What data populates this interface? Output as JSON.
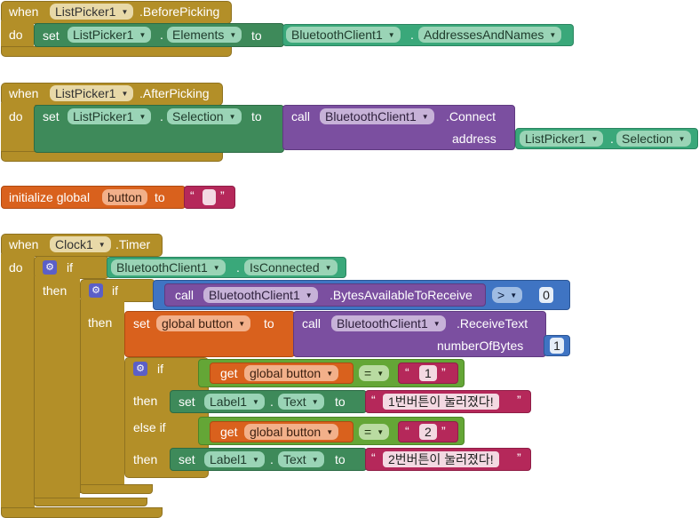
{
  "blocks": {
    "before_picking": {
      "when": "when",
      "component": "ListPicker1",
      "event": ".BeforePicking",
      "do": "do",
      "set": "set",
      "target": "ListPicker1",
      "dot": ".",
      "property": "Elements",
      "to": "to",
      "value_component": "BluetoothClient1",
      "value_property": "AddressesAndNames"
    },
    "after_picking": {
      "when": "when",
      "component": "ListPicker1",
      "event": ".AfterPicking",
      "do": "do",
      "set": "set",
      "target": "ListPicker1",
      "dot": ".",
      "property": "Selection",
      "to": "to",
      "call": "call",
      "call_component": "BluetoothClient1",
      "method": ".Connect",
      "param": "address",
      "arg_component": "ListPicker1",
      "arg_property": "Selection"
    },
    "init_global": {
      "label": "initialize global",
      "name": "button",
      "to": "to",
      "value": ""
    },
    "timer": {
      "when": "when",
      "component": "Clock1",
      "event": ".Timer",
      "do": "do",
      "if1": "if",
      "then1": "then",
      "cond_component": "BluetoothClient1",
      "cond_property": "IsConnected",
      "if2": "if",
      "then2": "then",
      "call2": "call",
      "call2_component": "BluetoothClient1",
      "call2_method": ".BytesAvailableToReceive",
      "cmp_op": ">",
      "cmp_value": "0",
      "set3": "set",
      "set3_var": "global button",
      "set3_to": "to",
      "call3": "call",
      "call3_component": "BluetoothClient1",
      "call3_method": ".ReceiveText",
      "call3_param": "numberOfBytes",
      "call3_arg": "1",
      "if3": "if",
      "then3": "then",
      "elseif": "else if",
      "then4": "then",
      "get": "get",
      "get_var": "global button",
      "eq": "=",
      "eq_value1": "1",
      "eq_value2": "2",
      "set_a": "set",
      "label_a": "Label1",
      "prop_a": "Text",
      "to_a": "to",
      "text_a": "1번버튼이 눌러졌다!",
      "set_b": "set",
      "label_b": "Label1",
      "prop_b": "Text",
      "to_b": "to",
      "text_b": "2번버튼이 눌러졌다!"
    }
  },
  "icons": {
    "gear": "gear-icon",
    "dropdown": "chevron-down-icon"
  }
}
